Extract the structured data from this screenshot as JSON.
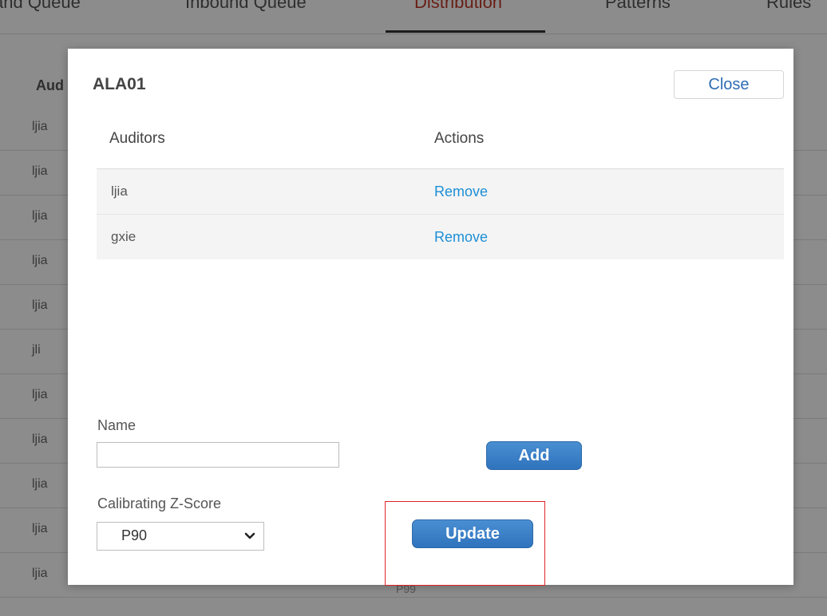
{
  "background": {
    "tabs": [
      {
        "label": "and Queue",
        "active": false
      },
      {
        "label": "Inbound Queue",
        "active": false
      },
      {
        "label": "Distribution",
        "active": true
      },
      {
        "label": "Patterns",
        "active": false
      },
      {
        "label": "Rules",
        "active": false
      }
    ],
    "header": "Aud",
    "rows": [
      "ljia",
      "ljia",
      "ljia",
      "ljia",
      "ljia",
      "jli",
      "ljia",
      "ljia",
      "ljia",
      "ljia",
      "ljia"
    ],
    "extra_cell": "P99"
  },
  "modal": {
    "title": "ALA01",
    "close_label": "Close",
    "table": {
      "columns": [
        "Auditors",
        "Actions"
      ],
      "rows": [
        {
          "auditor": "ljia",
          "action": "Remove"
        },
        {
          "auditor": "gxie",
          "action": "Remove"
        }
      ]
    },
    "name_label": "Name",
    "name_value": "",
    "add_label": "Add",
    "zscore_label": "Calibrating Z-Score",
    "zscore_value": "P90",
    "update_label": "Update"
  },
  "colors": {
    "overlay": "#000000",
    "link": "#1d8fd6",
    "primary_button": "#3a7fc8",
    "active_tab": "#c0392b",
    "highlight": "#e0262b"
  }
}
